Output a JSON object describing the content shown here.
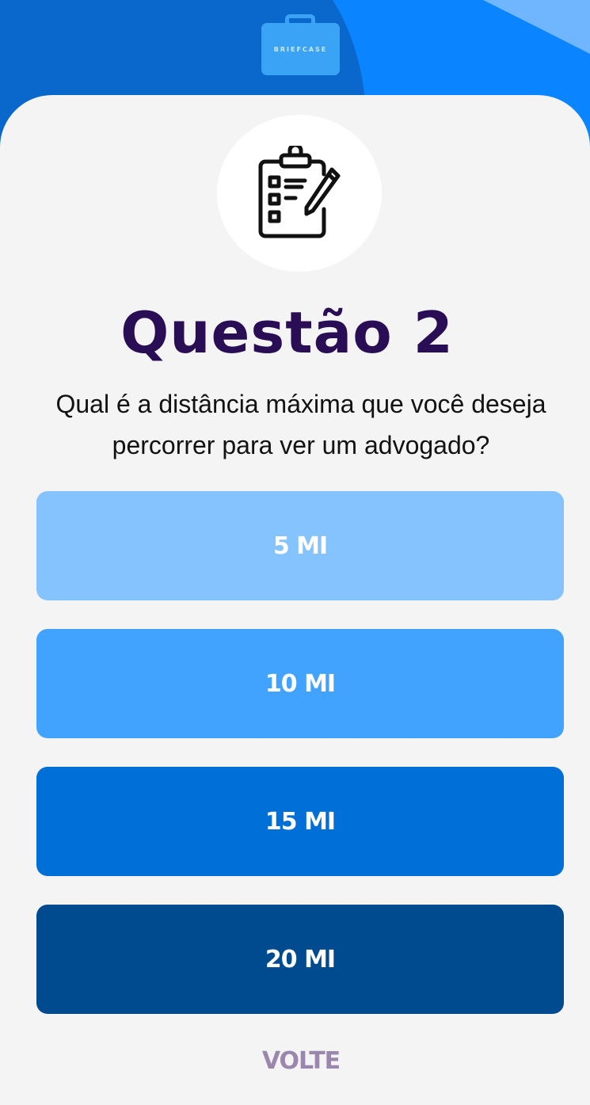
{
  "logo": {
    "text": "BRIEFCASE"
  },
  "question": {
    "title": "Questão 2",
    "text": "Qual é a distância máxima que você deseja percorrer para ver um advogado?"
  },
  "options": [
    {
      "label": "5 MI",
      "color": "#84c3fe"
    },
    {
      "label": "10 MI",
      "color": "#41a3fe"
    },
    {
      "label": "15 MI",
      "color": "#006fd8"
    },
    {
      "label": "20 MI",
      "color": "#004a90"
    }
  ],
  "back_label": "VOLTE",
  "colors": {
    "hero_dark": "#0a67cc",
    "hero_mid": "#0a84ff",
    "hero_light": "#6fb6ff",
    "title": "#2a0e55",
    "back": "#9b87ae",
    "background": "#f4f4f5"
  },
  "icons": {
    "question_icon": "clipboard-checklist-icon",
    "logo_icon": "briefcase-icon"
  }
}
